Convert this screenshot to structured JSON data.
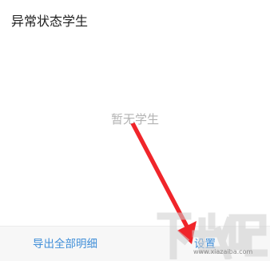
{
  "header": {
    "title": "异常状态学生"
  },
  "empty_state": {
    "message": "暂无学生"
  },
  "bottom_bar": {
    "export_label": "导出全部明细",
    "settings_label": "设置"
  },
  "watermark": {
    "logo_text": "下载吧",
    "url": "www.xiazaiba.com"
  },
  "colors": {
    "accent": "#3f8ed8",
    "annotation_arrow": "#f0252a",
    "empty_text": "#b3b3b3"
  }
}
